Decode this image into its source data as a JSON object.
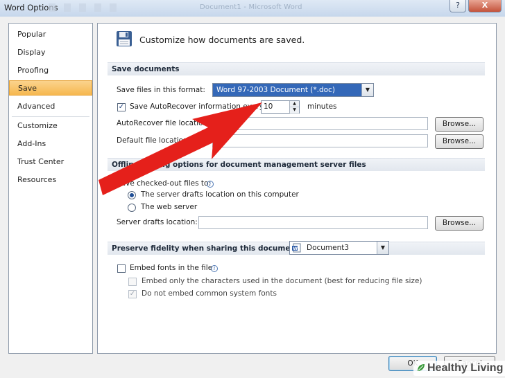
{
  "window": {
    "title": "Word Options",
    "background_title": "Document1 - Microsoft Word",
    "help_glyph": "?",
    "close_glyph": "X"
  },
  "nav": {
    "items": [
      {
        "label": "Popular"
      },
      {
        "label": "Display"
      },
      {
        "label": "Proofing"
      },
      {
        "label": "Save",
        "selected": true
      },
      {
        "label": "Advanced"
      },
      {
        "label": "Customize"
      },
      {
        "label": "Add-Ins"
      },
      {
        "label": "Trust Center"
      },
      {
        "label": "Resources"
      }
    ]
  },
  "header": {
    "text": "Customize how documents are saved."
  },
  "save_documents": {
    "section_title": "Save documents",
    "format_label": "Save files in this format:",
    "format_value": "Word 97-2003 Document (*.doc)",
    "autorecover_label": "Save AutoRecover information every",
    "autorecover_checked": true,
    "autorecover_minutes": "10",
    "minutes_label": "minutes",
    "autorecover_location_label": "AutoRecover file location:",
    "autorecover_location_value": "",
    "default_location_label": "Default file location:",
    "default_location_value": "",
    "browse_label": "Browse..."
  },
  "offline": {
    "section_title": "Offline editing options for document management server files",
    "save_to_label": "Save checked-out files to:",
    "option_server_drafts": "The server drafts location on this computer",
    "option_web_server": "The web server",
    "selected_option": "The server drafts location on this computer",
    "server_drafts_label": "Server drafts location:",
    "server_drafts_value": "",
    "browse_label": "Browse..."
  },
  "fidelity": {
    "section_title": "Preserve fidelity when sharing this document:",
    "document_value": "Document3",
    "embed_fonts_label": "Embed fonts in the file",
    "embed_fonts_checked": false,
    "embed_chars_label": "Embed only the characters used in the document (best for reducing file size)",
    "embed_chars_checked": false,
    "no_system_fonts_label": "Do not embed common system fonts",
    "no_system_fonts_checked": true
  },
  "footer": {
    "ok_label": "OK",
    "cancel_label": "Cancel"
  },
  "watermark": {
    "text": "Healthy Living"
  },
  "colors": {
    "accent_arrow": "#e5201b",
    "selected_nav": "#f6b84f",
    "selected_format": "#3468b8"
  },
  "icons": {
    "header": "floppy-disk-icon",
    "info": "info-icon",
    "document": "word-document-icon"
  }
}
